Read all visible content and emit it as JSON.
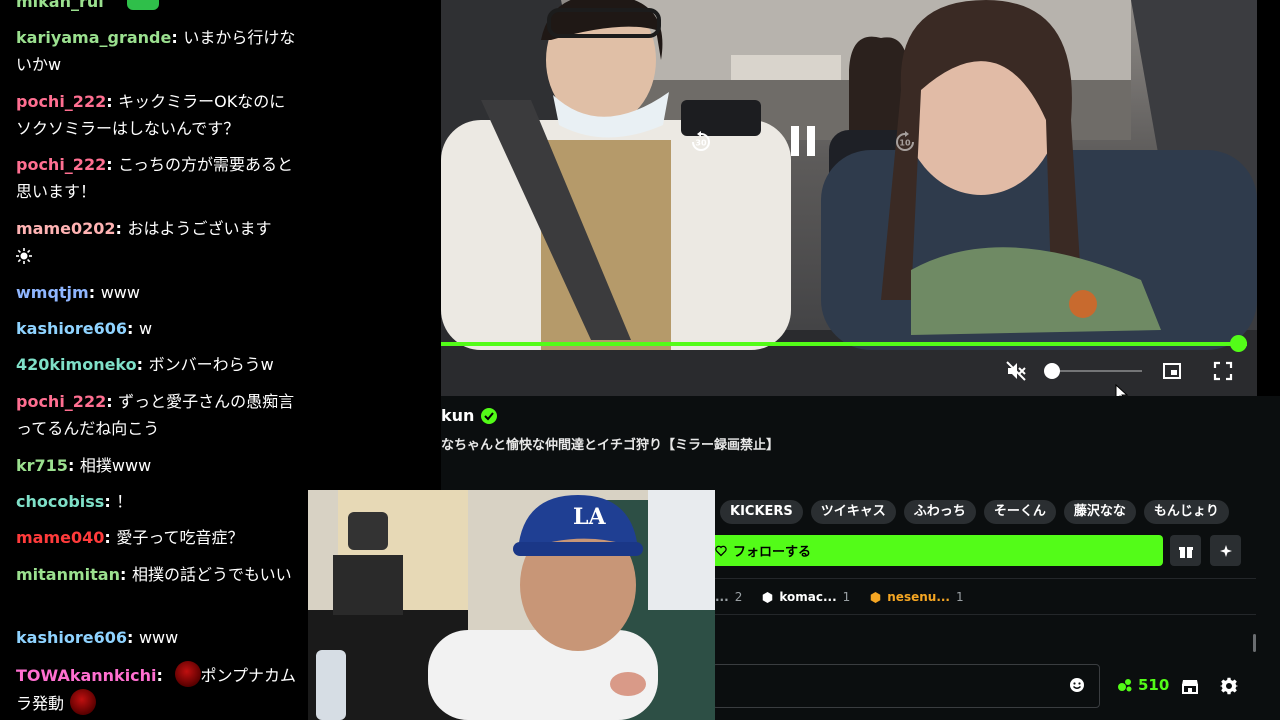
{
  "chat": {
    "top_user": "mikan_rui",
    "messages": [
      {
        "user": "kariyama_grande",
        "color": "#9be08f",
        "text": "いまから行けないかw"
      },
      {
        "user": "pochi_222",
        "color": "#ff6f91",
        "text": "キックミラーOKなのにソクソミラーはしないんです？"
      },
      {
        "user": "pochi_222",
        "color": "#ff6f91",
        "text": "こっちの方が需要あると思います！"
      },
      {
        "user": "mame0202",
        "color": "#ffb3b3",
        "text": "おはようございます"
      },
      {
        "user": "wmqtjm",
        "color": "#8fb6ff",
        "text": "www"
      },
      {
        "user": "kashiore606",
        "color": "#8fd3ff",
        "text": "w"
      },
      {
        "user": "420kimoneko",
        "color": "#7fe0c8",
        "text": "ボンバーわらうw"
      },
      {
        "user": "pochi_222",
        "color": "#ff6f91",
        "text": "ずっと愛子さんの愚痴言ってるんだね向こう"
      },
      {
        "user": "kr715",
        "color": "#9be08f",
        "text": "相撲www"
      },
      {
        "user": "chocobiss",
        "color": "#7fe0c8",
        "text": "！"
      },
      {
        "user": "mame040",
        "color": "#ff3b3b",
        "text": "愛子って吃音症？"
      },
      {
        "user": "mitanmitan",
        "color": "#9be08f",
        "text": "相撲の話どうでもいい"
      },
      {
        "user": "kashiore606",
        "color": "#8fd3ff",
        "text": "www"
      },
      {
        "user": "TOWAkannkichi",
        "color": "#ff6fd0",
        "text": "ポンプナカムラ発動"
      }
    ]
  },
  "stream": {
    "streamer_name": "kun",
    "title": "なちゃんと愉快な仲間達とイチゴ狩り【ミラー録画禁止】",
    "progress": 1.0,
    "volume": 0.0,
    "muted": true,
    "playing": true,
    "skip_back_label": "30",
    "skip_fwd_label": "10"
  },
  "tags": [
    "KICKERS",
    "ツイキャス",
    "ふわっち",
    "そーくん",
    "藤沢なな",
    "もんじょり"
  ],
  "follow_label": "フォローする",
  "gifters": [
    {
      "name": "...",
      "count": "2",
      "color": "#9aa0a4"
    },
    {
      "name": "komac...",
      "count": "1",
      "color": "#ffffff"
    },
    {
      "name": "nesenu...",
      "count": "1",
      "color": "#f5a623"
    }
  ],
  "points": "510",
  "colors": {
    "accent": "#53fc18",
    "panel": "#0b0e0f",
    "chip": "#2a2e31"
  }
}
